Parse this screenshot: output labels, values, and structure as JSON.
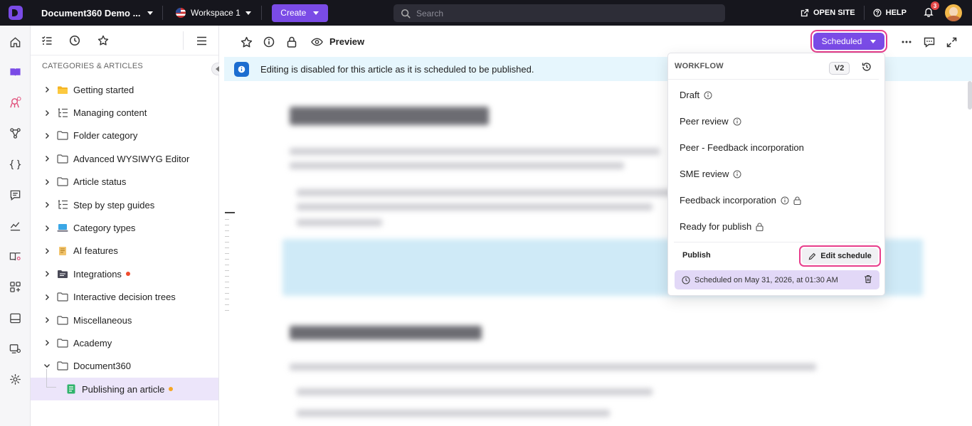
{
  "topbar": {
    "project_name": "Document360 Demo ...",
    "workspace_name": "Workspace 1",
    "create_label": "Create",
    "search_placeholder": "Search",
    "open_site_label": "OPEN SITE",
    "help_label": "HELP",
    "notification_count": "3"
  },
  "sidebar": {
    "heading": "CATEGORIES & ARTICLES",
    "items": [
      {
        "label": "Getting started",
        "icon": "folder-yellow-icon"
      },
      {
        "label": "Managing content",
        "icon": "tree-list-icon"
      },
      {
        "label": "Folder category",
        "icon": "folder-icon"
      },
      {
        "label": "Advanced WYSIWYG Editor",
        "icon": "folder-icon"
      },
      {
        "label": "Article status",
        "icon": "folder-icon"
      },
      {
        "label": "Step by step guides",
        "icon": "tree-list-icon"
      },
      {
        "label": "Category types",
        "icon": "laptop-icon"
      },
      {
        "label": "AI features",
        "icon": "scroll-icon"
      },
      {
        "label": "Integrations",
        "icon": "folder-dark-icon"
      },
      {
        "label": "Interactive decision trees",
        "icon": "folder-icon"
      },
      {
        "label": "Miscellaneous",
        "icon": "folder-icon"
      },
      {
        "label": "Academy",
        "icon": "folder-icon"
      },
      {
        "label": "Document360",
        "icon": "folder-icon"
      },
      {
        "label": "Publishing an article",
        "icon": "article-green-icon"
      }
    ]
  },
  "toolbar": {
    "preview_label": "Preview",
    "status_label": "Scheduled"
  },
  "banner": {
    "text": "Editing is disabled for this article as it is scheduled to be published."
  },
  "workflow": {
    "title": "WORKFLOW",
    "version": "V2",
    "statuses": [
      {
        "label": "Draft",
        "suffix_icon": "info-icon"
      },
      {
        "label": "Peer review",
        "suffix_icon": "info-icon"
      },
      {
        "label": "Peer - Feedback incorporation",
        "suffix_icon": ""
      },
      {
        "label": "SME review",
        "suffix_icon": "info-icon"
      },
      {
        "label": "Feedback incorporation",
        "suffix_icon": "info-lock-icon"
      },
      {
        "label": "Ready for publish",
        "suffix_icon": "lock-icon"
      }
    ],
    "publish_label": "Publish",
    "edit_schedule_label": "Edit schedule",
    "scheduled_text": "Scheduled on May 31, 2026, at 01:30 AM"
  },
  "colors": {
    "accent": "#7a4be6",
    "highlight": "#e83e8c",
    "topbar": "#16161d",
    "banner": "#e6f6fd",
    "selected_row": "#ece5fa",
    "dot_red": "#f04b2d",
    "dot_orange": "#f5a623"
  }
}
